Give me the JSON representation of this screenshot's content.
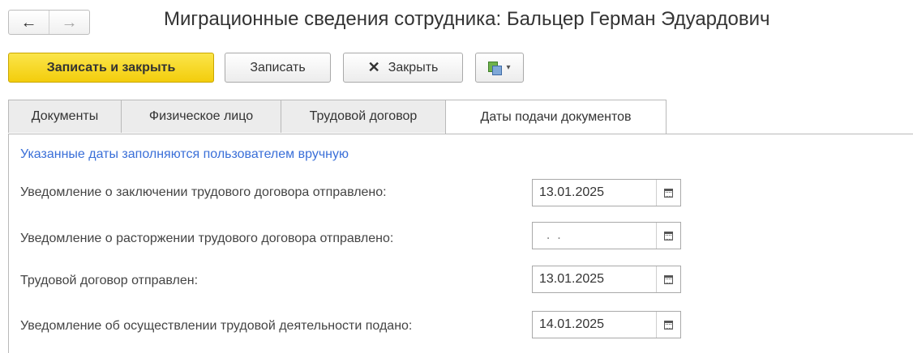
{
  "nav": {
    "back_glyph": "←",
    "forward_glyph": "→"
  },
  "title": "Миграционные сведения сотрудника: Бальцер Герман Эдуардович",
  "toolbar": {
    "save_close_label": "Записать и закрыть",
    "save_label": "Записать",
    "close_glyph": "✕",
    "close_label": "Закрыть",
    "more_caret": "▾"
  },
  "tabs": [
    {
      "label": "Документы"
    },
    {
      "label": "Физическое лицо"
    },
    {
      "label": "Трудовой договор"
    },
    {
      "label": "Даты подачи документов",
      "active": true
    }
  ],
  "hint": "Указанные даты заполняются пользователем вручную",
  "fields": [
    {
      "label": "Уведомление о заключении трудового договора отправлено:",
      "value": "13.01.2025"
    },
    {
      "label": "Уведомление о расторжении трудового договора отправлено:",
      "value": "  .  ."
    },
    {
      "label": "Трудовой договор отправлен:",
      "value": "13.01.2025"
    },
    {
      "label": "Уведомление об осуществлении трудовой деятельности подано:",
      "value": "14.01.2025"
    }
  ],
  "colors": {
    "primary_button": "#f5d31a",
    "hint_text": "#3a6fd8"
  }
}
